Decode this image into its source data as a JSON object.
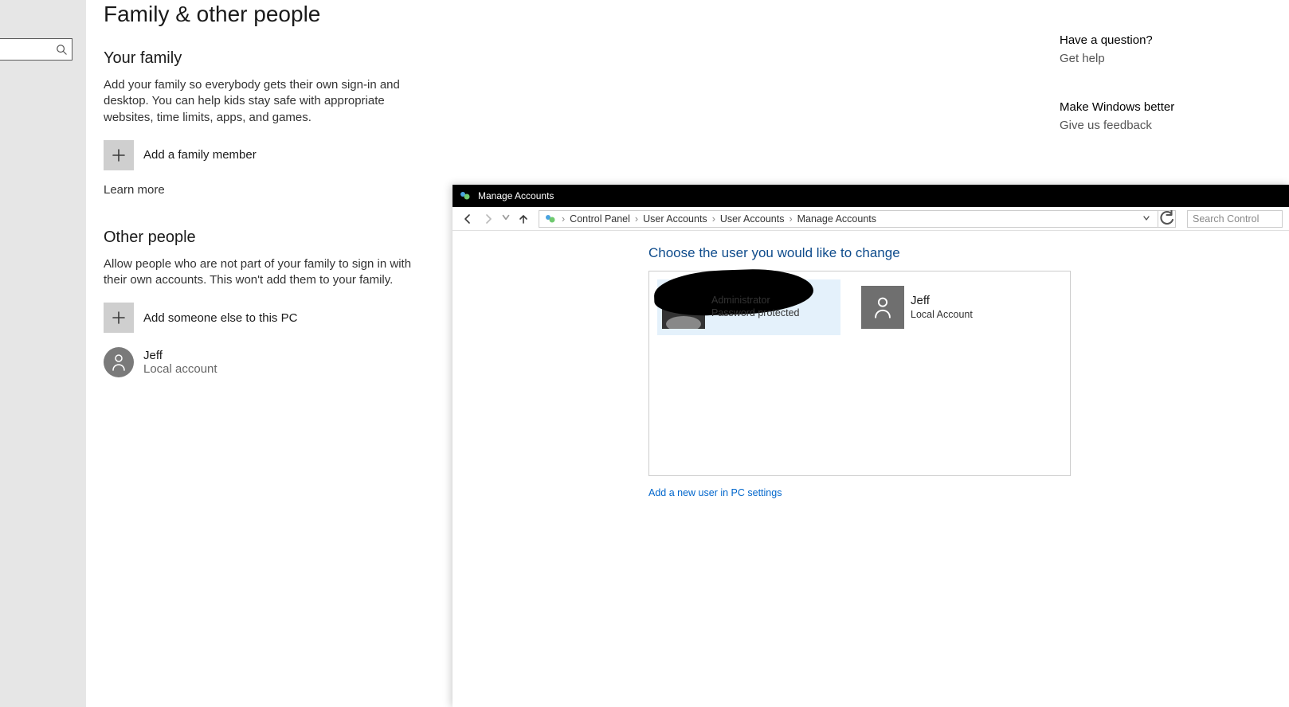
{
  "settings": {
    "page_title": "Family & other people",
    "search_placeholder": "",
    "family": {
      "heading": "Your family",
      "desc": "Add your family so everybody gets their own sign-in and desktop. You can help kids stay safe with appropriate websites, time limits, apps, and games.",
      "add_label": "Add a family member",
      "learn_more": "Learn more"
    },
    "other": {
      "heading": "Other people",
      "desc": "Allow people who are not part of your family to sign in with their own accounts. This won't add them to your family.",
      "add_label": "Add someone else to this PC",
      "users": [
        {
          "name": "Jeff",
          "sub": "Local account"
        }
      ]
    },
    "right": {
      "q_heading": "Have a question?",
      "q_link": "Get help",
      "better_heading": "Make Windows better",
      "better_link": "Give us feedback"
    }
  },
  "cp": {
    "title": "Manage Accounts",
    "breadcrumbs": [
      "Control Panel",
      "User Accounts",
      "User Accounts",
      "Manage Accounts"
    ],
    "search_placeholder": "Search Control",
    "heading": "Choose the user you would like to change",
    "accounts": [
      {
        "name": "",
        "role": "Administrator",
        "pw": "Password protected",
        "selected": true,
        "redacted": true
      },
      {
        "name": "Jeff",
        "role": "Local Account",
        "pw": "",
        "selected": false,
        "redacted": false
      }
    ],
    "add_link": "Add a new user in PC settings"
  }
}
